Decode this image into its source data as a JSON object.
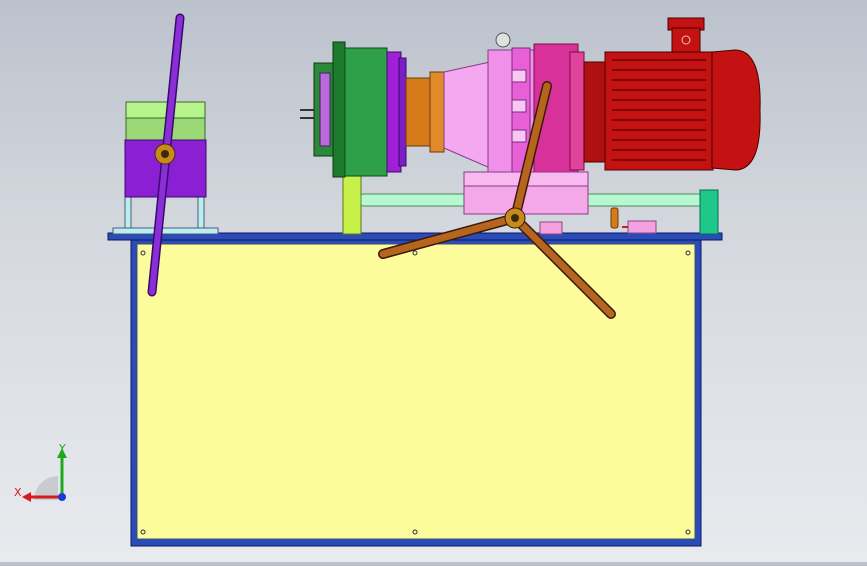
{
  "viewport": {
    "background_top": "#bcc2cc",
    "background_bottom": "#e8eaee"
  },
  "triad": {
    "x_label": "X",
    "y_label": "Y",
    "x_color": "#d41a1a",
    "y_color": "#1fa81f",
    "z_color": "#1a3ad4"
  },
  "model": {
    "tank_color": "#fcfc9c",
    "frame_color": "#2a4bb8",
    "motor_color": "#c41212",
    "reducer_color": "#e94fc9",
    "coupling_color": "#d67a1a",
    "flange_color": "#1e8a2e",
    "lever_color": "#7a1fc4",
    "handwheel_color": "#a0522d",
    "pipe_color": "#a8f0c0",
    "pump_block_color": "#9ad878"
  }
}
